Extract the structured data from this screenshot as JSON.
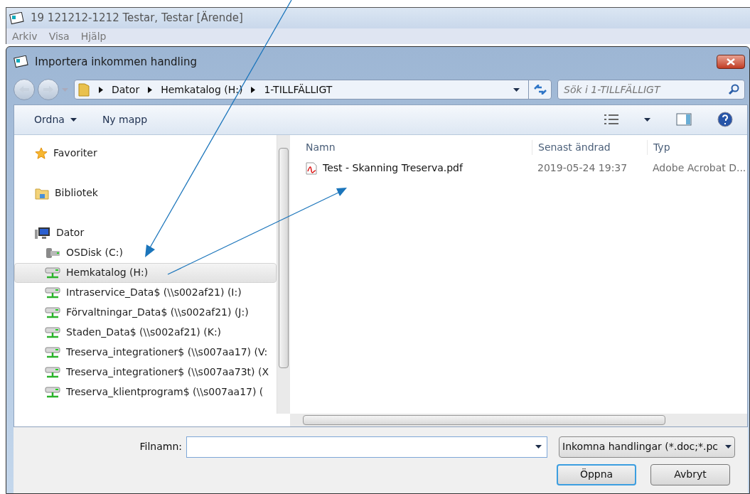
{
  "app_window": {
    "title": "19 121212-1212 Testar, Testar [Ärende]",
    "menu": [
      "Arkiv",
      "Visa",
      "Hjälp"
    ]
  },
  "dialog": {
    "title": "Importera inkommen handling",
    "breadcrumb": [
      "Dator",
      "Hemkatalog (H:)",
      "1-TILLFÄLLIGT"
    ],
    "search": {
      "placeholder": "Sök i 1-TILLFÄLLIGT"
    },
    "toolbar": [
      {
        "label": "Ordna",
        "kind": "menu"
      },
      {
        "label": "Ny mapp",
        "kind": "button"
      }
    ],
    "sidebar": [
      {
        "label": "Favoriter",
        "kind": "favorites",
        "selected": false
      },
      {
        "label": "Bibliotek",
        "kind": "library",
        "selected": false
      },
      {
        "label": "Dator",
        "kind": "computer",
        "selected": false,
        "children": [
          {
            "label": "OSDisk (C:)",
            "kind": "local-drive",
            "selected": false
          },
          {
            "label": "Hemkatalog (H:)",
            "kind": "network-drive",
            "selected": true
          },
          {
            "label": "Intraservice_Data$ (\\\\s002af21) (I:)",
            "kind": "network-drive",
            "selected": false
          },
          {
            "label": "Förvaltningar_Data$ (\\\\s002af21) (J:)",
            "kind": "network-drive",
            "selected": false
          },
          {
            "label": "Staden_Data$ (\\\\s002af21) (K:)",
            "kind": "network-drive",
            "selected": false
          },
          {
            "label": "Treserva_integrationer$ (\\\\s007aa17) (V:",
            "kind": "network-drive",
            "selected": false
          },
          {
            "label": "Treserva_integrationer$ (\\\\s007aa73t) (X",
            "kind": "network-drive",
            "selected": false
          },
          {
            "label": "Treserva_klientprogram$ (\\\\s007aa17) (",
            "kind": "network-drive",
            "selected": false
          }
        ]
      }
    ],
    "file_list": {
      "columns": [
        "Namn",
        "Senast ändrad",
        "Typ"
      ],
      "rows": [
        {
          "name": "Test - Skanning Treserva.pdf",
          "modified": "2019-05-24 19:37",
          "type": "Adobe Acrobat D..."
        }
      ]
    },
    "filename": {
      "label": "Filnamn:"
    },
    "filter": "Inkomna handlingar (*.doc;*.pc",
    "buttons": [
      {
        "label": "Öppna",
        "kind": "default"
      },
      {
        "label": "Avbryt",
        "kind": "normal"
      }
    ]
  }
}
